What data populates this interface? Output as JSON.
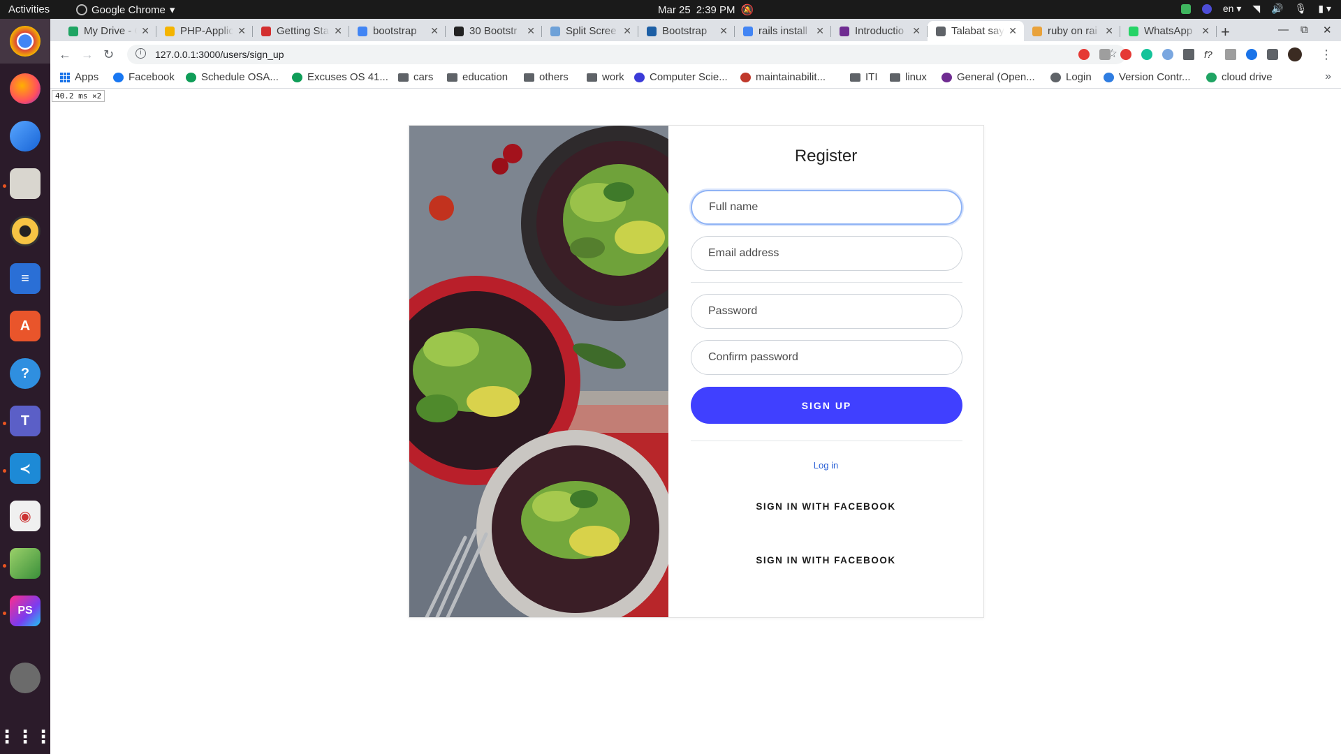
{
  "topbar": {
    "activities": "Activities",
    "app_name": "Google Chrome",
    "date": "Mar 25",
    "time": "2:39 PM",
    "language": "en"
  },
  "dock": {
    "items": [
      "chrome-icon",
      "firefox-icon",
      "thunderbird-icon",
      "files-icon",
      "rhythmbox-icon",
      "writer-icon",
      "app-store-icon",
      "help-icon",
      "teams-icon",
      "vscode-icon",
      "document-viewer-icon",
      "image-editor-icon",
      "phpstorm-icon",
      "disk-icon"
    ],
    "colors": {
      "chrome": "#4285f4",
      "firefox": "#ff7139",
      "accent": "#e95420"
    }
  },
  "tabs": [
    {
      "title": "My Drive - G",
      "color": "#1fa463"
    },
    {
      "title": "PHP-Applic",
      "color": "#f4b400"
    },
    {
      "title": "Getting Sta",
      "color": "#d32f2f"
    },
    {
      "title": "bootstrap",
      "color": "#4285f4"
    },
    {
      "title": "30 Bootstr",
      "color": "#222222"
    },
    {
      "title": "Split Scree",
      "color": "#6ea1d8"
    },
    {
      "title": "Bootstrap",
      "color": "#1d5fa5"
    },
    {
      "title": "rails install",
      "color": "#4285f4"
    },
    {
      "title": "Introductio",
      "color": "#6f2c91"
    },
    {
      "title": "Talabat say",
      "color": "#5f6368"
    },
    {
      "title": "ruby on rai",
      "color": "#e9a23b"
    },
    {
      "title": "WhatsApp",
      "color": "#25d366"
    }
  ],
  "toolbar": {
    "url": "127.0.0.1:3000/users/sign_up"
  },
  "bookmarks": [
    {
      "label": "Apps",
      "type": "apps"
    },
    {
      "label": "Facebook",
      "type": "icon",
      "color": "#1877f2"
    },
    {
      "label": "Schedule OSA...",
      "type": "icon",
      "color": "#0f9d58"
    },
    {
      "label": "Excuses OS 41...",
      "type": "icon",
      "color": "#0f9d58"
    },
    {
      "label": "cars",
      "type": "folder"
    },
    {
      "label": "education",
      "type": "folder"
    },
    {
      "label": "others",
      "type": "folder"
    },
    {
      "label": "work",
      "type": "folder"
    },
    {
      "label": "Computer Scie...",
      "type": "icon",
      "color": "#3b3bd8"
    },
    {
      "label": "maintainabilit...",
      "type": "icon",
      "color": "#c0392b"
    },
    {
      "label": "ITI",
      "type": "folder"
    },
    {
      "label": "linux",
      "type": "folder"
    },
    {
      "label": "General (Open...",
      "type": "icon",
      "color": "#6f2c91"
    },
    {
      "label": "Login",
      "type": "icon",
      "color": "#5f6368"
    },
    {
      "label": "Version Contr...",
      "type": "icon",
      "color": "#2f7de1"
    },
    {
      "label": "cloud drive",
      "type": "icon",
      "color": "#1fa463"
    }
  ],
  "perf_overlay": "40.2 ms ×2",
  "form": {
    "title": "Register",
    "fullname_placeholder": "Full name",
    "email_placeholder": "Email address",
    "password_placeholder": "Password",
    "confirm_placeholder": "Confirm password",
    "signup_label": "SIGN UP",
    "login_label": "Log in",
    "social_1": "SIGN IN WITH FACEBOOK",
    "social_2": "SIGN IN WITH FACEBOOK",
    "primary_color": "#4040ff",
    "link_color": "#2d62d6"
  }
}
